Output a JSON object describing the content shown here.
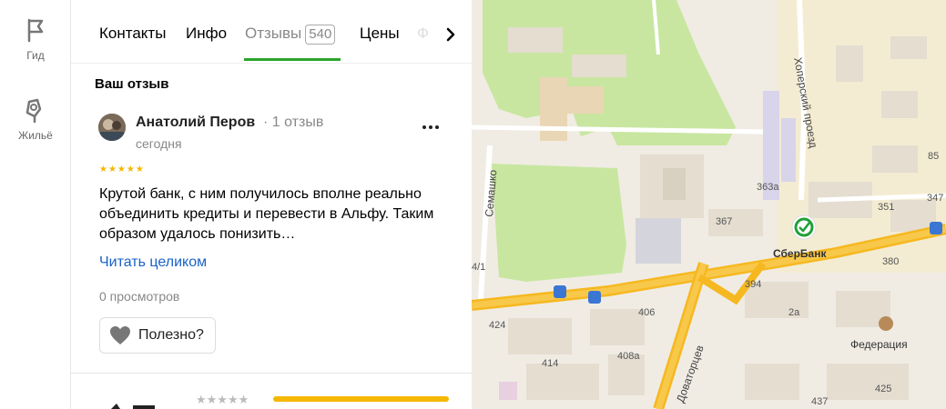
{
  "rail": {
    "guide_label": "Гид",
    "housing_label": "Жильё"
  },
  "tabs": {
    "contacts": "Контакты",
    "info": "Инфо",
    "reviews": "Отзывы",
    "reviews_count": "540",
    "prices": "Цены",
    "faded": "Ф"
  },
  "review": {
    "section_title": "Ваш отзыв",
    "author": "Анатолий Перов",
    "author_reviews": "· 1 отзыв",
    "date": "сегодня",
    "rating": 5,
    "text": "Крутой банк, с ним получилось вполне реально объединить кредиты и перевести в Альфу. Таким образом удалось понизить…",
    "read_more": "Читать целиком",
    "views": "0 просмотров",
    "helpful": "Полезно?"
  },
  "summary": {
    "bar_fraction": 1.0
  },
  "map": {
    "streets": {
      "hopersky": "Хоперский проезд",
      "semashko": "Семашко",
      "dovatortsev": "Доваторцев"
    },
    "house_numbers": [
      "85",
      "347",
      "351",
      "363a",
      "367",
      "380",
      "394",
      "2a",
      "406",
      "408a",
      "414",
      "424",
      "425",
      "437",
      "4/1"
    ],
    "pois": {
      "sberbank": "СберБанк",
      "federation": "Федерация"
    },
    "colors": {
      "road": "#f6b820",
      "park": "#c8e6a0",
      "building": "#e4ddd0",
      "sber_green": "#21a038"
    }
  }
}
